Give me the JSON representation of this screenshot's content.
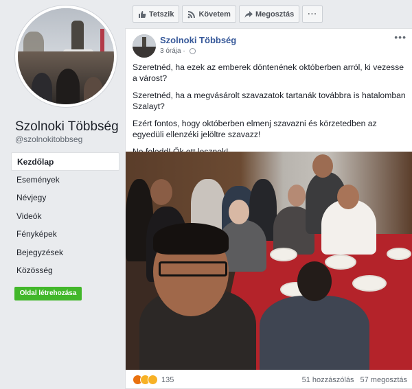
{
  "sidebar": {
    "page_name": "Szolnoki Többség",
    "handle": "@szolnokitobbseg",
    "nav": [
      {
        "label": "Kezdőlap",
        "active": true
      },
      {
        "label": "Események"
      },
      {
        "label": "Névjegy"
      },
      {
        "label": "Videók"
      },
      {
        "label": "Fényképek"
      },
      {
        "label": "Bejegyzések"
      },
      {
        "label": "Közösség"
      }
    ],
    "create_page_label": "Oldal létrehozása"
  },
  "actionbar": {
    "like_label": "Tetszik",
    "follow_label": "Követem",
    "share_label": "Megosztás",
    "more_label": "···"
  },
  "post": {
    "author": "Szolnoki Többség",
    "time": "3 órája",
    "time_separator": " · ",
    "menu_label": "•••",
    "paragraphs": [
      "Szeretnéd, ha ezek az emberek döntenének októberben arról, ki vezesse a várost?",
      "Szeretnéd, ha a megvásárolt szavazatok tartanák továbbra is hatalomban Szalayt?",
      "Ezért fontos, hogy októberben elmenj szavazni és körzetedben az egyedüli ellenzéki jelöltre szavazz!",
      "Ne feledd! Ők ott lesznek!"
    ],
    "reaction_count": "135",
    "comments": "51 hozzászólás",
    "shares": "57 megosztás"
  },
  "colors": {
    "link": "#365899",
    "green": "#42b72a",
    "background": "#e9ebee"
  },
  "icons": {
    "like": "thumbs-up-icon",
    "follow": "rss-icon",
    "share": "share-arrow-icon",
    "globe": "globe-icon"
  }
}
